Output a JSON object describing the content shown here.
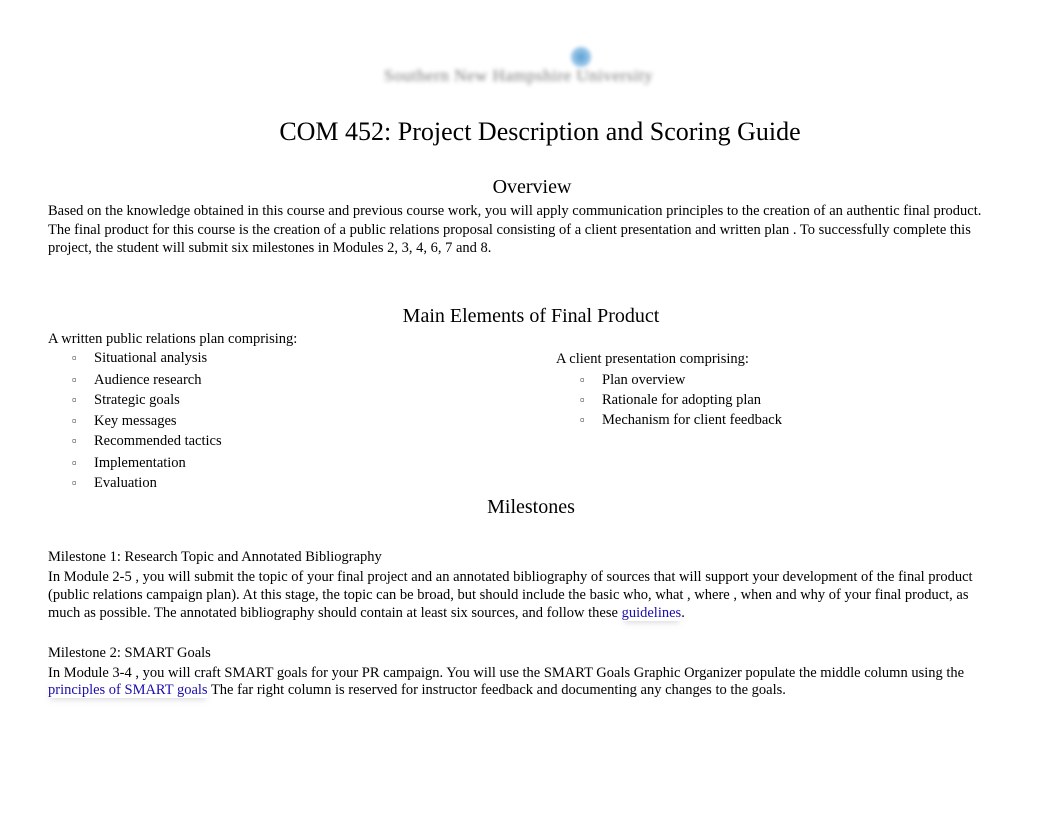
{
  "header": {
    "logo_text": "Southern New Hampshire University",
    "title": "COM 452: Project Description and Scoring Guide"
  },
  "overview": {
    "heading": "Overview",
    "lines": [
      "Based on the knowledge obtained in this course and previous course work, you will apply communication principles to the creation of an authentic final product.",
      "The final product for this course is the creation of a  public relations proposal  consisting of a client presentation   and written plan  . To successfully complete this",
      "project, the student will submit  six milestones in Modules 2, 3, 4, 6, 7 and 8."
    ]
  },
  "main_elements": {
    "heading": "Main Elements of Final Product",
    "written_plan": {
      "intro": "A written public relations plan   comprising:",
      "items": [
        "Situational analysis",
        "Audience research",
        "Strategic goals",
        "Key messages",
        "Recommended tactics",
        "Implementation",
        "Evaluation"
      ]
    },
    "client_presentation": {
      "intro": "A client presentation   comprising:",
      "items": [
        "Plan overview",
        "Rationale for adopting plan",
        "Mechanism for client feedback"
      ]
    },
    "bullet_glyph": ""
  },
  "milestones": {
    "heading": "Milestones",
    "m1": {
      "title": "Milestone 1: Research Topic and Annotated Bibliography",
      "line1": "In Module 2-5 , you will submit the topic of your final project and an annotated bibliography   of sources that will support your development of the final product",
      "line2": "(public relations campaign plan). At this stage, the topic can be broad, but should include the basic   who, what , where , when  and why of your final product, as",
      "line3_pre": "much as possible. The annotated bibliography should contain at least   six sources, and follow these ",
      "line3_link": "guidelines",
      "line3_post": "."
    },
    "m2": {
      "title": "Milestone 2: SMART Goals",
      "line1": "In Module 3-4 , you will craft SMART goals for your PR campaign. You will use the SMART Goals Graphic Organizer populate the middle column using the",
      "line2_link": "principles of SMART goals",
      "line2_post": " The far right column is reserved for instructor feedback and documenting any changes to the goals."
    }
  }
}
